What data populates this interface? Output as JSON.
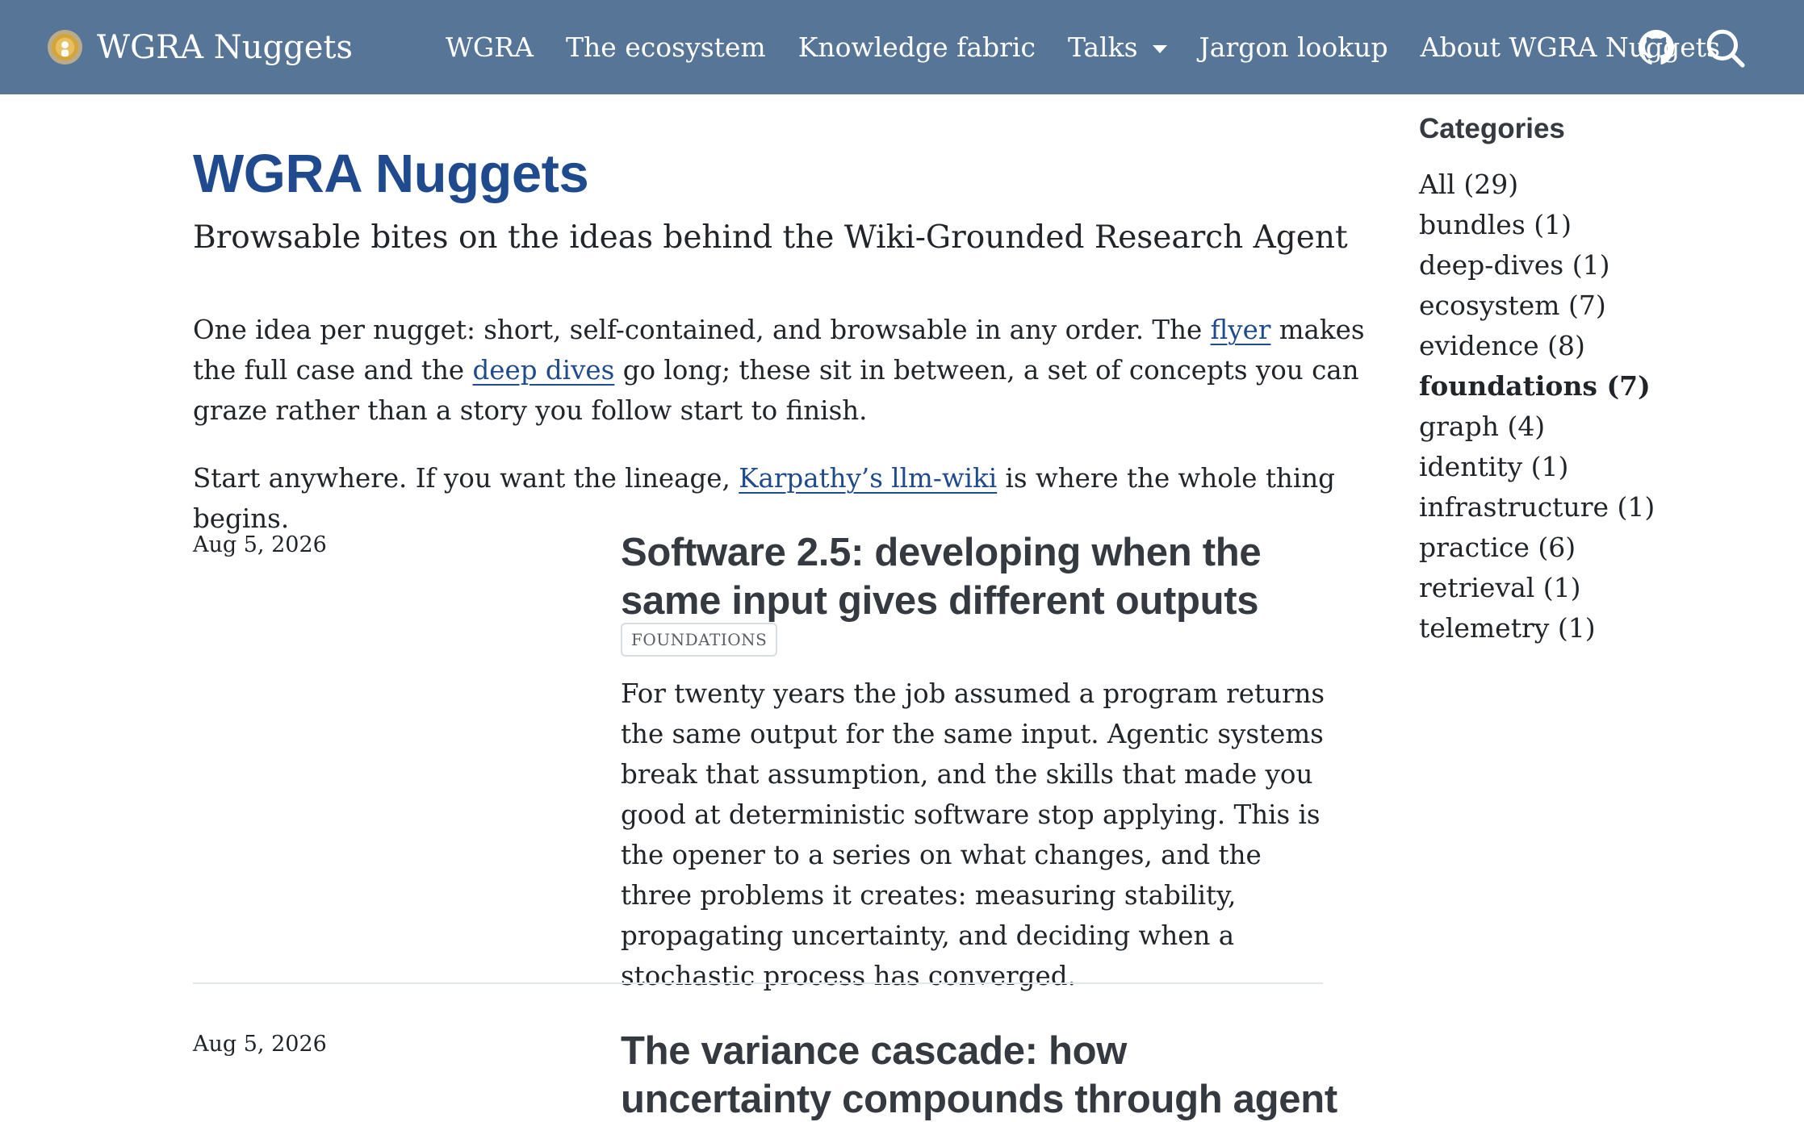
{
  "navbar": {
    "brand_title": "WGRA Nuggets",
    "brand_logo_icon": "wgra-logo-icon",
    "items": [
      {
        "label": "WGRA"
      },
      {
        "label": "The ecosystem"
      },
      {
        "label": "Knowledge fabric"
      },
      {
        "label": "Talks",
        "has_dropdown": true
      },
      {
        "label": "Jargon lookup"
      },
      {
        "label": "About WGRA Nuggets"
      }
    ],
    "github_icon": "github-icon",
    "search_icon": "search-icon",
    "background_color": "#577597"
  },
  "main": {
    "title": "WGRA Nuggets",
    "subtitle": "Browsable bites on the ideas behind the Wiki-Grounded Research Agent",
    "intro": {
      "p1_a": "One idea per nugget: short, self-contained, and browsable in any order. The ",
      "p1_link1": "flyer",
      "p1_b": " makes the full case and the ",
      "p1_link2": "deep dives",
      "p1_c": " go long; these sit in between, a set of concepts you can graze rather than a story you follow start to finish.",
      "p2_a": "Start anywhere. If you want the lineage, ",
      "p2_link": "Karpathy’s llm-wiki",
      "p2_b": " is where the whole thing begins."
    },
    "posts": [
      {
        "date": "Aug 5, 2026",
        "title": "Software 2.5: developing when the same input gives different outputs",
        "tag": "FOUNDATIONS",
        "summary": "For twenty years the job assumed a program returns the same output for the same input. Agentic systems break that assumption, and the skills that made you good at deterministic software stop applying. This is the opener to a series on what changes, and the three problems it creates: measuring stability, propagating uncertainty, and deciding when a stochastic process has converged."
      },
      {
        "date": "Aug 5, 2026",
        "title": "The variance cascade: how uncertainty compounds through agent chains"
      }
    ],
    "title_color": "#1f4b8e",
    "link_color": "#1f4b8e"
  },
  "sidebar": {
    "title": "Categories",
    "categories": [
      {
        "label": "All (29)"
      },
      {
        "label": "bundles (1)"
      },
      {
        "label": "deep-dives (1)"
      },
      {
        "label": "ecosystem (7)"
      },
      {
        "label": "evidence (8)"
      },
      {
        "label": "foundations (7)",
        "active": true
      },
      {
        "label": "graph (4)"
      },
      {
        "label": "identity (1)"
      },
      {
        "label": "infrastructure (1)"
      },
      {
        "label": "practice (6)"
      },
      {
        "label": "retrieval (1)"
      },
      {
        "label": "telemetry (1)"
      }
    ]
  }
}
